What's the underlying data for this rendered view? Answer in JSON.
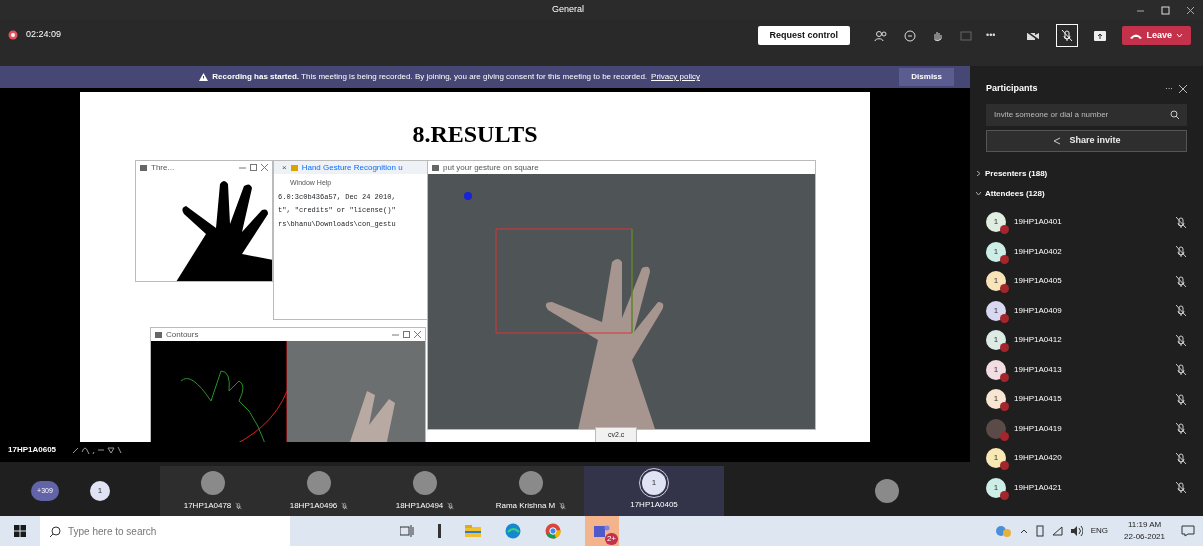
{
  "window": {
    "title": "General"
  },
  "meeting_bar": {
    "timer": "02:24:09",
    "recording": true,
    "request_control": "Request control",
    "more": "•••",
    "leave": "Leave"
  },
  "banner": {
    "text": "**Recording has started.** This meeting is being recorded. By joining, you are giving consent for this meeting to be recorded.",
    "link": "Privacy policy",
    "dismiss": "Dismiss"
  },
  "slide": {
    "title": "8.RESULTS",
    "threshold_window": {
      "title": "Thre..."
    },
    "editor_window": {
      "tab_close": "×",
      "tab_title": "Hand Gesture Recognition u",
      "menu": "Window  Help",
      "lines": [
        "6.0:3c0b436a57, Dec 24 2010,",
        "t\", \"credits\" or \"license()\"",
        "rs\\bhanu\\Downloads\\con_gestu"
      ]
    },
    "gesture_window": {
      "title": "put your gesture on square"
    },
    "contours_window": {
      "title": "Contours"
    },
    "console_tab": "cv2.c"
  },
  "presenter_label": "17HP1A0605",
  "video_strip": [
    {
      "kind": "overflow",
      "label": "+309"
    },
    {
      "kind": "avatar",
      "initial": "1"
    },
    {
      "kind": "video",
      "name": "17HP1A0478",
      "muted": true
    },
    {
      "kind": "video",
      "name": "18HP1A0496",
      "muted": true
    },
    {
      "kind": "video",
      "name": "18HP1A0494",
      "muted": true
    },
    {
      "kind": "video",
      "name": "Rama Krishna M",
      "muted": true
    },
    {
      "kind": "speaker",
      "name": "17HP1A0405",
      "initial": "1",
      "muted": false
    },
    {
      "kind": "video"
    }
  ],
  "participants": {
    "title": "Participants",
    "more": "···",
    "search_placeholder": "Invite someone or dial a number",
    "share_invite": "Share invite",
    "sections": [
      {
        "label": "Presenters (188)",
        "expanded": false
      },
      {
        "label": "Attendees (128)",
        "expanded": true
      }
    ],
    "members": [
      {
        "name": "19HP1A0401",
        "initial": "1",
        "kind": "avatar",
        "color": "#dfeee0",
        "muted": true
      },
      {
        "name": "19HP1A0402",
        "initial": "1",
        "kind": "avatar",
        "color": "#cdeee7",
        "muted": true
      },
      {
        "name": "19HP1A0405",
        "initial": "1",
        "kind": "avatar",
        "color": "#f8e4b8",
        "muted": true
      },
      {
        "name": "19HP1A0409",
        "initial": "1",
        "kind": "avatar",
        "color": "#d9d8f2",
        "muted": true
      },
      {
        "name": "19HP1A0412",
        "initial": "1",
        "kind": "avatar",
        "color": "#dcebe3",
        "muted": true
      },
      {
        "name": "19HP1A0413",
        "initial": "1",
        "kind": "avatar",
        "color": "#f2dde3",
        "muted": true
      },
      {
        "name": "19HP1A0415",
        "initial": "1",
        "kind": "avatar",
        "color": "#f8e6d2",
        "muted": true
      },
      {
        "name": "19HP1A0419",
        "kind": "photo",
        "muted": true
      },
      {
        "name": "19HP1A0420",
        "initial": "1",
        "kind": "avatar",
        "color": "#f8e8b4",
        "muted": true
      },
      {
        "name": "19HP1A0421",
        "initial": "1",
        "kind": "avatar",
        "color": "#cdeee7",
        "muted": true
      }
    ]
  },
  "taskbar": {
    "search_placeholder": "Type here to search",
    "teams_badge": "2+",
    "language": "ENG",
    "time": "11:19 AM",
    "date": "22-06-2021"
  }
}
